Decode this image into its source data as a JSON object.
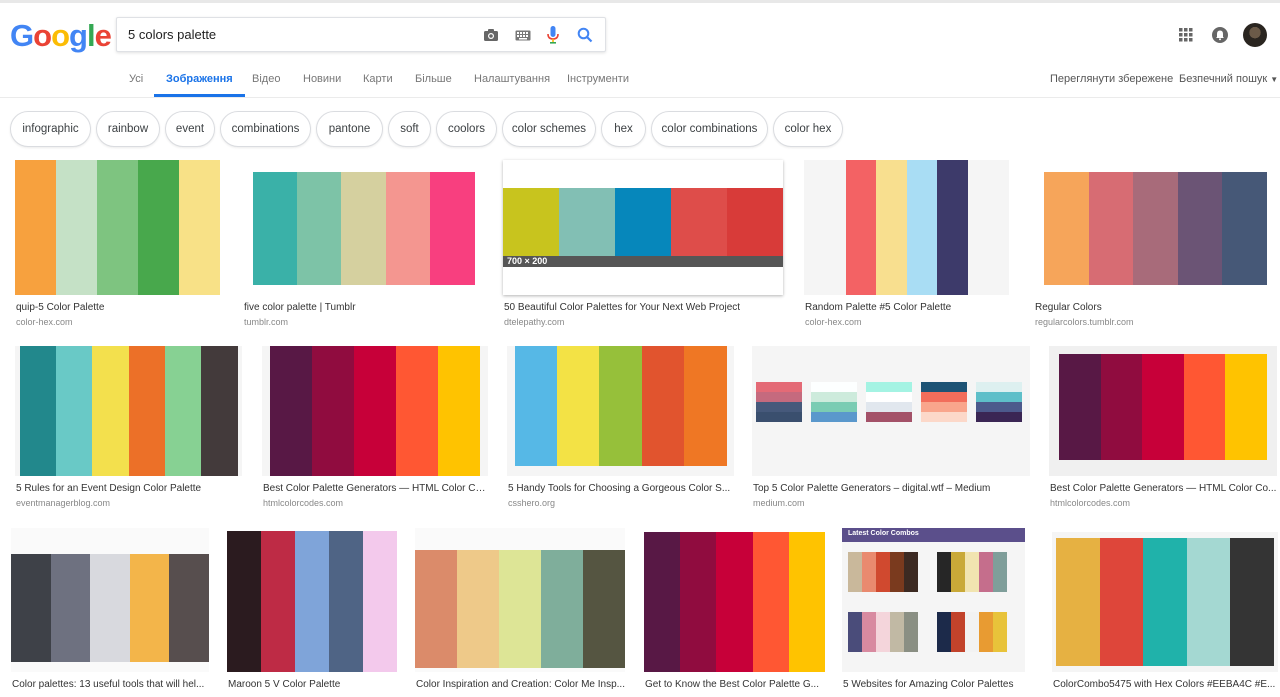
{
  "header": {
    "logo_letters": [
      {
        "ch": "G",
        "color": "#4285F4"
      },
      {
        "ch": "o",
        "color": "#EA4335"
      },
      {
        "ch": "o",
        "color": "#FBBC05"
      },
      {
        "ch": "g",
        "color": "#4285F4"
      },
      {
        "ch": "l",
        "color": "#34A853"
      },
      {
        "ch": "e",
        "color": "#EA4335"
      }
    ],
    "search_value": "5 colors palette",
    "icons": [
      "camera-icon",
      "keyboard-icon",
      "mic-icon",
      "search-icon",
      "apps-grid-icon",
      "notifications-icon"
    ]
  },
  "tabs": {
    "all": "Усі",
    "images": "Зображення",
    "videos": "Відео",
    "news": "Новини",
    "maps": "Карти",
    "more": "Більше",
    "settings": "Налаштування",
    "tools": "Інструменти",
    "saved": "Переглянути збережене",
    "safesearch": "Безпечний пошук"
  },
  "chips": [
    "infographic",
    "rainbow",
    "event",
    "combinations",
    "pantone",
    "soft",
    "coolors",
    "color schemes",
    "hex",
    "color combinations",
    "color hex"
  ],
  "results": [
    {
      "caption": "quip-5 Color Palette",
      "domain": "color-hex.com",
      "colors": [
        "#F7A13E",
        "#C5E1C6",
        "#7EC480",
        "#48A84C",
        "#F8E187"
      ]
    },
    {
      "caption": "five color palette | Tumblr",
      "domain": "tumblr.com",
      "colors": [
        "#3AB1A8",
        "#7DC3A7",
        "#D5D09F",
        "#F49690",
        "#F83F7F"
      ]
    },
    {
      "caption": "50 Beautiful Color Palettes for Your Next Web Project",
      "domain": "dtelepathy.com",
      "colors": [
        "#C8C41E",
        "#82BFB4",
        "#0687BB",
        "#DE4D4A",
        "#D83B39"
      ],
      "overlay": "700 × 200"
    },
    {
      "caption": "Random Palette #5 Color Palette",
      "domain": "color-hex.com",
      "colors": [
        "#F36264",
        "#F8DF8F",
        "#A9DDF4",
        "#3D3A6A"
      ]
    },
    {
      "caption": "Regular Colors",
      "domain": "regularcolors.tumblr.com",
      "colors": [
        "#F6A55A",
        "#D76C73",
        "#A86B7A",
        "#6B5475",
        "#465877"
      ]
    },
    {
      "caption": "5 Rules for an Event Design Color Palette",
      "domain": "eventmanagerblog.com",
      "colors": [
        "#22888C",
        "#69C9C6",
        "#F3E04D",
        "#EC7028",
        "#87D193",
        "#433A3B"
      ]
    },
    {
      "caption": "Best Color Palette Generators — HTML Color Co...",
      "domain": "htmlcolorcodes.com",
      "colors": [
        "#581845",
        "#900C3F",
        "#C70039",
        "#FF5733",
        "#FFC300"
      ]
    },
    {
      "caption": "5 Handy Tools for Choosing a Gorgeous Color S...",
      "domain": "csshero.org",
      "colors": [
        "#56B8E6",
        "#F3E245",
        "#96C03A",
        "#E1542E",
        "#EF7724"
      ]
    },
    {
      "caption": "Top 5 Color Palette Generators – digital.wtf – Medium",
      "domain": "medium.com",
      "colors": [
        "#E46A76",
        "#FDFFFF",
        "#A4F3E3",
        "#1D5375",
        "#DDF0F0"
      ]
    },
    {
      "caption": "Best Color Palette Generators — HTML Color Co...",
      "domain": "htmlcolorcodes.com",
      "colors": [
        "#581845",
        "#900C3F",
        "#C70039",
        "#FF5733",
        "#FFC300"
      ]
    },
    {
      "caption": "Color palettes: 13 useful tools that will hel...",
      "domain": "",
      "colors": [
        "#3E4148",
        "#6E7180",
        "#D8D9DE",
        "#F3B54A",
        "#574E4E"
      ]
    },
    {
      "caption": "Maroon 5 V Color Palette",
      "domain": "",
      "colors": [
        "#2B1B1F",
        "#BE2B45",
        "#7FA4D9",
        "#4F6485",
        "#F3C9EC"
      ]
    },
    {
      "caption": "Color Inspiration and Creation: Color Me Insp...",
      "domain": "",
      "colors": [
        "#DB8B6A",
        "#EEC989",
        "#DDE596",
        "#7FAE9B",
        "#555541"
      ]
    },
    {
      "caption": "Get to Know the Best Color Palette G...",
      "domain": "",
      "colors": [
        "#581845",
        "#900C3F",
        "#C70039",
        "#FF5733",
        "#FFC300"
      ]
    },
    {
      "caption": "5 Websites for Amazing Color Palettes",
      "domain": "",
      "colors": [
        "#F2F2F2"
      ],
      "panel_title": "Latest Color Combos"
    },
    {
      "caption": "ColorCombo5475 with Hex Colors #EEBA4C #E...",
      "domain": "",
      "colors": [
        "#E6B142",
        "#DE463A",
        "#20B2AA",
        "#A4D8D2",
        "#343434"
      ]
    }
  ]
}
